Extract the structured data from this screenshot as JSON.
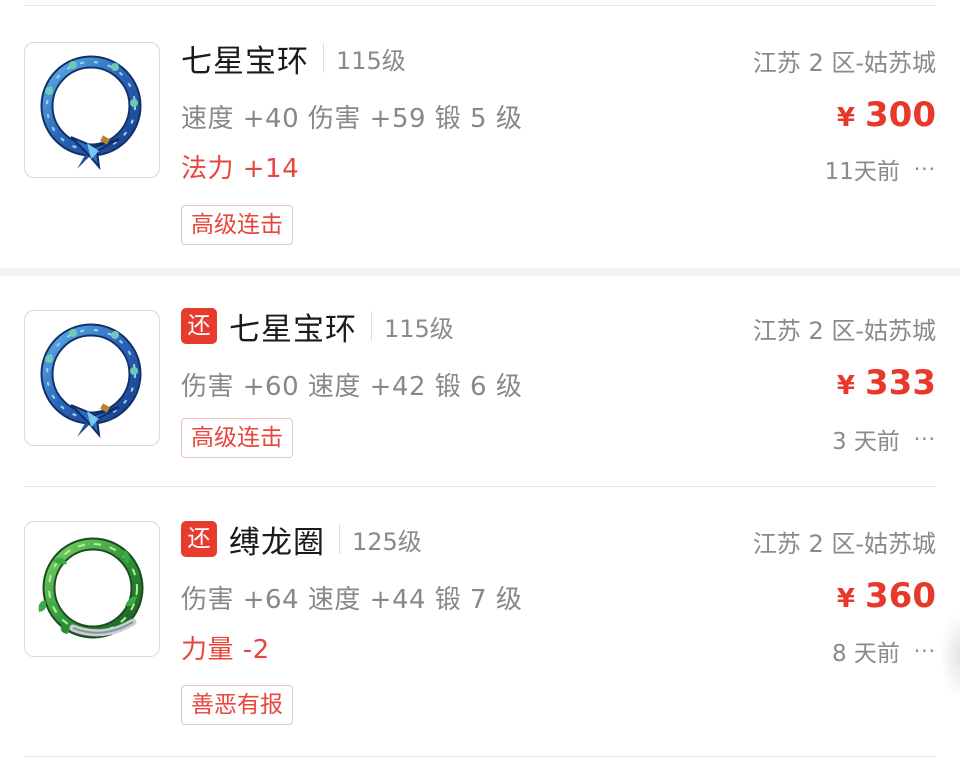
{
  "listings": [
    {
      "has_return_badge": false,
      "return_badge": "",
      "name": "七星宝环",
      "level": "115级",
      "stats": "速度 +40 伤害 +59 锻 5 级",
      "extra_stat": "法力 +14",
      "tag": "高级连击",
      "region": "江苏 2 区-姑苏城",
      "currency": "¥",
      "price": "300",
      "posted": "11天前",
      "icon": "blue-ring-icon"
    },
    {
      "has_return_badge": true,
      "return_badge": "还",
      "name": "七星宝环",
      "level": "115级",
      "stats": "伤害 +60 速度 +42 锻 6 级",
      "extra_stat": "",
      "tag": "高级连击",
      "region": "江苏 2 区-姑苏城",
      "currency": "¥",
      "price": "333",
      "posted": "3 天前",
      "icon": "blue-ring-icon"
    },
    {
      "has_return_badge": true,
      "return_badge": "还",
      "name": "缚龙圈",
      "level": "125级",
      "stats": "伤害 +64 速度 +44 锻 7 级",
      "extra_stat": "力量 -2",
      "tag": "善恶有报",
      "region": "江苏 2 区-姑苏城",
      "currency": "¥",
      "price": "360",
      "posted": "8 天前",
      "icon": "green-ring-icon"
    }
  ],
  "more_label": "···",
  "colors": {
    "price": "#e8382b",
    "badge": "#e63b2e",
    "tag_border": "#e9c3bf",
    "muted_text": "#888888"
  }
}
